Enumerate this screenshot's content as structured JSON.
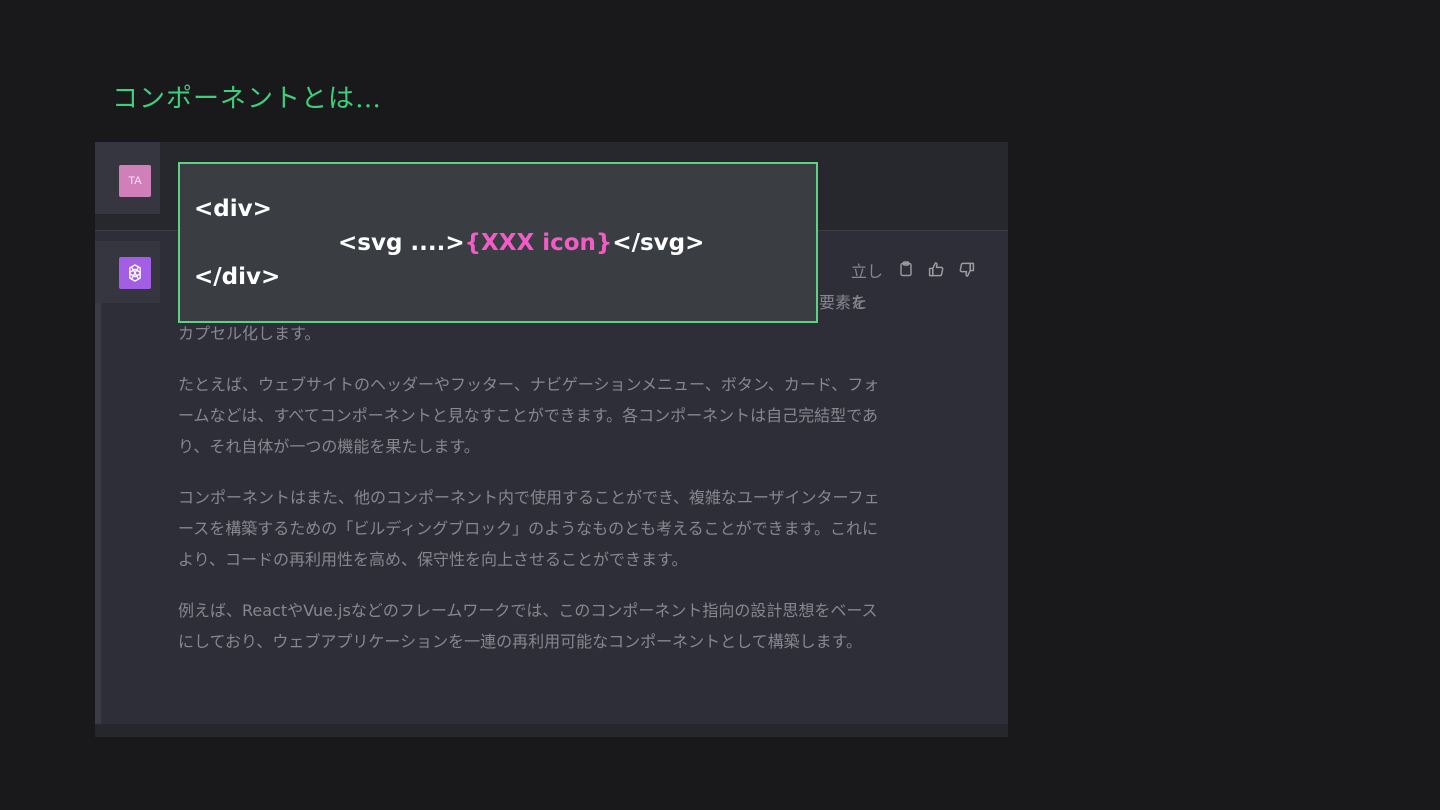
{
  "slide": {
    "title": "コンポーネントとは…"
  },
  "user": {
    "avatar_initials": "TA"
  },
  "assistant": {
    "hidden_line1_tail": "立した",
    "hidden_line2_tail": "要素を",
    "paragraphs": [
      "カプセル化します。",
      "たとえば、ウェブサイトのヘッダーやフッター、ナビゲーションメニュー、ボタン、カード、フォームなどは、すべてコンポーネントと見なすことができます。各コンポーネントは自己完結型であり、それ自体が一つの機能を果たします。",
      "コンポーネントはまた、他のコンポーネント内で使用することができ、複雑なユーザインターフェースを構築するための「ビルディングブロック」のようなものとも考えることができます。これにより、コードの再利用性を高め、保守性を向上させることができます。",
      "例えば、ReactやVue.jsなどのフレームワークでは、このコンポーネント指向の設計思想をベースにしており、ウェブアプリケーションを一連の再利用可能なコンポーネントとして構築します。"
    ],
    "actions": [
      {
        "icon": "clipboard-icon"
      },
      {
        "icon": "thumbs-up-icon"
      },
      {
        "icon": "thumbs-down-icon"
      }
    ]
  },
  "code_overlay": {
    "line1": "<div>",
    "line2_prefix": "<svg ....>",
    "line2_highlight": "{XXX icon}",
    "line2_suffix": "</svg>",
    "line3": "</div>",
    "highlight_color": "#f25cc6",
    "border_color": "#5ed184"
  },
  "colors": {
    "title": "#3ecf7a",
    "user_avatar": "#d17fb9",
    "bot_avatar": "#a35ee4"
  }
}
